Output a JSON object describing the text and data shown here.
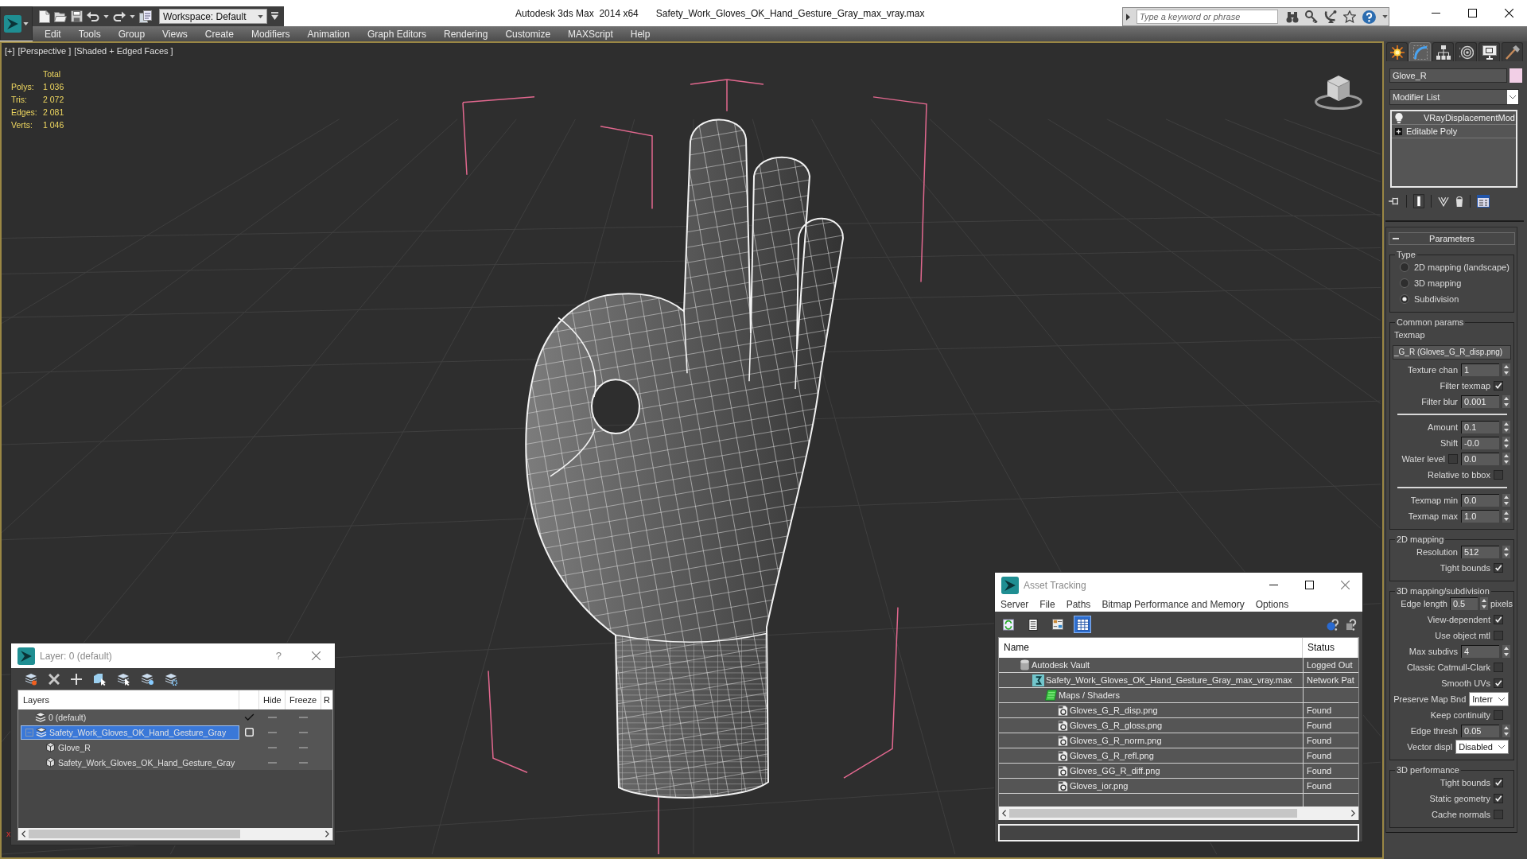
{
  "title_bar": {
    "workspace": "Workspace: Default",
    "app_title": "Autodesk 3ds Max  2014 x64",
    "file_title": "Safety_Work_Gloves_OK_Hand_Gesture_Gray_max_vray.max",
    "search": {
      "placeholder": "Type a keyword or phrase"
    }
  },
  "menu": [
    "Edit",
    "Tools",
    "Group",
    "Views",
    "Create",
    "Modifiers",
    "Animation",
    "Graph Editors",
    "Rendering",
    "Customize",
    "MAXScript",
    "Help"
  ],
  "viewport": {
    "labels": [
      "[+]",
      "[Perspective ]",
      "[Shaded + Edged Faces ]"
    ],
    "stats": {
      "heading": "Total",
      "rows": [
        {
          "label": "Polys:",
          "value": "1 036"
        },
        {
          "label": "Tris:",
          "value": "2 072"
        },
        {
          "label": "Edges:",
          "value": "2 081"
        },
        {
          "label": "Verts:",
          "value": "1 046"
        }
      ]
    },
    "axis_label": "x"
  },
  "command_panel": {
    "tabs": [
      {
        "kind": "create",
        "selected": false
      },
      {
        "kind": "modify",
        "selected": true
      },
      {
        "kind": "hierarchy",
        "selected": false
      },
      {
        "kind": "motion",
        "selected": false
      },
      {
        "kind": "display",
        "selected": false
      },
      {
        "kind": "utilities",
        "selected": false
      }
    ],
    "object_name": "Glove_R",
    "modifier_list": "Modifier List",
    "modifier_stack": [
      {
        "kind": "modifier",
        "label": "VRayDisplacementMod",
        "selected": false
      },
      {
        "kind": "base",
        "label": "Editable Poly",
        "selected": false
      }
    ],
    "rollout": {
      "title": "Parameters",
      "groups": [
        {
          "title": "Type",
          "rows": [
            {
              "kind": "radio",
              "label": "2D mapping (landscape)",
              "selected": false
            },
            {
              "kind": "radio",
              "label": "3D mapping",
              "selected": false
            },
            {
              "kind": "radio",
              "label": "Subdivision",
              "selected": true
            }
          ]
        },
        {
          "title": "Common params",
          "rows": [
            {
              "kind": "label",
              "label": "Texmap"
            },
            {
              "kind": "map",
              "value": "_G_R (Gloves_G_R_disp.png)"
            },
            {
              "kind": "spinner",
              "label": "Texture chan",
              "value": "1"
            },
            {
              "kind": "checkbox",
              "label": "Filter texmap",
              "checked": true
            },
            {
              "kind": "spinner",
              "label": "Filter blur",
              "value": "0.001"
            },
            {
              "kind": "separator"
            },
            {
              "kind": "spinner",
              "label": "Amount",
              "value": "0.1"
            },
            {
              "kind": "spinner",
              "label": "Shift",
              "value": "-0.0"
            },
            {
              "kind": "check_spinner",
              "label": "Water level",
              "checked": false,
              "value": "0.0"
            },
            {
              "kind": "checkbox",
              "label": "Relative to bbox",
              "checked": false
            },
            {
              "kind": "separator"
            },
            {
              "kind": "spinner",
              "label": "Texmap min",
              "value": "0.0"
            },
            {
              "kind": "spinner",
              "label": "Texmap max",
              "value": "1.0"
            }
          ]
        },
        {
          "title": "2D mapping",
          "rows": [
            {
              "kind": "spinner",
              "label": "Resolution",
              "value": "512"
            },
            {
              "kind": "checkbox",
              "label": "Tight bounds",
              "checked": true
            }
          ]
        },
        {
          "title": "3D mapping/subdivision",
          "rows": [
            {
              "kind": "spinner",
              "label": "Edge length",
              "value": "0.5",
              "unit": "pixels"
            },
            {
              "kind": "checkbox",
              "label": "View-dependent",
              "checked": true
            },
            {
              "kind": "checkbox",
              "label": "Use object mtl",
              "checked": false
            },
            {
              "kind": "spinner",
              "label": "Max subdivs",
              "value": "4"
            },
            {
              "kind": "checkbox",
              "label": "Classic Catmull-Clark",
              "checked": false
            },
            {
              "kind": "checkbox",
              "label": "Smooth UVs",
              "checked": true
            },
            {
              "kind": "dropdown",
              "label": "Preserve Map Bnd",
              "value": "Interr"
            },
            {
              "kind": "checkbox",
              "label": "Keep continuity",
              "checked": false
            },
            {
              "kind": "spinner",
              "label": "Edge thresh",
              "value": "0.05"
            },
            {
              "kind": "dropdown",
              "label": "Vector displ",
              "value": "Disabled"
            }
          ]
        },
        {
          "title": "3D performance",
          "rows": [
            {
              "kind": "checkbox",
              "label": "Tight bounds",
              "checked": true
            },
            {
              "kind": "checkbox",
              "label": "Static geometry",
              "checked": true
            },
            {
              "kind": "checkbox",
              "label": "Cache normals",
              "checked": false
            }
          ]
        }
      ]
    }
  },
  "layer_window": {
    "title": "Layer: 0 (default)",
    "help": "?",
    "columns": [
      "Layers",
      "Hide",
      "Freeze",
      "R"
    ],
    "layers": [
      {
        "name": "0 (default)",
        "current": true,
        "selected": false
      },
      {
        "name": "Safety_Work_Gloves_OK_Hand_Gesture_Gray",
        "current": false,
        "selected": true,
        "expanded": true,
        "children": [
          {
            "name": "Glove_R",
            "selected": false
          },
          {
            "name": "Safety_Work_Gloves_OK_Hand_Gesture_Gray",
            "selected": false
          }
        ]
      }
    ]
  },
  "asset_tracking": {
    "title": "Asset Tracking",
    "menu": [
      "Server",
      "File",
      "Paths",
      "Bitmap Performance and Memory",
      "Options"
    ],
    "toolbar": [
      {
        "kind": "refresh",
        "selected": false
      },
      {
        "kind": "list",
        "selected": false
      },
      {
        "kind": "thumbnails",
        "selected": false
      },
      {
        "kind": "table",
        "selected": true
      }
    ],
    "columns": [
      "Name",
      "Status"
    ],
    "tree": [
      {
        "kind": "vault",
        "name": "Autodesk Vault",
        "status": "Logged Out",
        "selected": false,
        "children": [
          {
            "kind": "scene",
            "name": "Safety_Work_Gloves_OK_Hand_Gesture_Gray_max_vray.max",
            "status": "Network Pat",
            "selected": false,
            "children": [
              {
                "kind": "folder",
                "name": "Maps / Shaders",
                "selected": false,
                "children": [
                  {
                    "kind": "image",
                    "name": "Gloves_G_R_disp.png",
                    "status": "Found",
                    "selected": false
                  },
                  {
                    "kind": "image",
                    "name": "Gloves_G_R_gloss.png",
                    "status": "Found",
                    "selected": false
                  },
                  {
                    "kind": "image",
                    "name": "Gloves_G_R_norm.png",
                    "status": "Found",
                    "selected": false
                  },
                  {
                    "kind": "image",
                    "name": "Gloves_G_R_refl.png",
                    "status": "Found",
                    "selected": false
                  },
                  {
                    "kind": "image",
                    "name": "Gloves_GG_R_diff.png",
                    "status": "Found",
                    "selected": false
                  },
                  {
                    "kind": "image",
                    "name": "Gloves_ior.png",
                    "status": "Found",
                    "selected": false
                  }
                ]
              }
            ]
          }
        ]
      }
    ]
  }
}
